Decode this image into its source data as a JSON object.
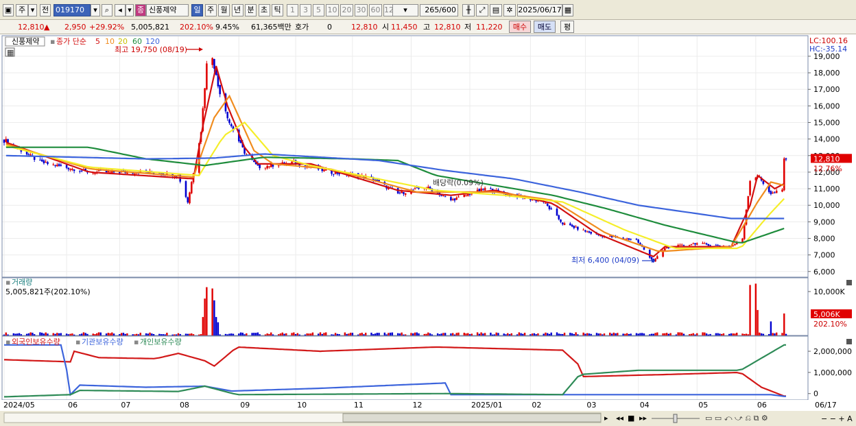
{
  "toolbar": {
    "market_primary": "주",
    "market_type": "전",
    "code": "019170",
    "name_badge": "종",
    "name": "신풍제약",
    "periods": [
      "일",
      "주",
      "월",
      "년",
      "분",
      "초",
      "틱"
    ],
    "active_period": "일",
    "intervals": [
      "1",
      "3",
      "5",
      "10",
      "20",
      "30",
      "60",
      "120"
    ],
    "count": "265",
    "count_max": "/600",
    "date": "2025/06/17"
  },
  "quote": {
    "price": "12,810",
    "change": "2,950",
    "change_pct": "+29.92%",
    "volume": "5,005,821",
    "volume_ratio": "202.10%",
    "turnover": "9.45%",
    "amount": "61,365백만",
    "ask_label": "호가",
    "ask_value": "0",
    "bid_value": "12,810",
    "open_label": "시",
    "open_value": "11,450",
    "high_label": "고",
    "high_value": "12,810",
    "low_label": "저",
    "low_value": "11,220",
    "buy_label": "매수",
    "sell_label": "매도",
    "eval_label": "평"
  },
  "colors": {
    "up": "#e00000",
    "down": "#0000d0",
    "ma5": "#d21010",
    "ma10": "#f08c1e",
    "ma20": "#f5ee2a",
    "ma60": "#1e8c3c",
    "ma120": "#3c64dc",
    "foreign": "#d21818",
    "institution": "#3c64dc",
    "individual": "#2e8b57"
  },
  "chart_data": [
    {
      "type": "candlestick",
      "title": "신풍제약",
      "legend": [
        "종가 단순",
        "5",
        "10",
        "20",
        "60",
        "120"
      ],
      "legend_placement": "top-left",
      "y_ticks": [
        "19,000",
        "18,000",
        "17,000",
        "16,000",
        "15,000",
        "14,000",
        "13,000",
        "12,000",
        "11,000",
        "10,000",
        "9,000",
        "8,000",
        "7,000",
        "6,000"
      ],
      "ylim": [
        5700,
        20200
      ],
      "x_ticks": [
        "2024/05",
        "06",
        "07",
        "08",
        "09",
        "10",
        "11",
        "12",
        "2025/01",
        "02",
        "03",
        "04",
        "05",
        "06",
        "06/17"
      ],
      "top_labels": [
        "LC:100.16",
        "HC:-35.14"
      ],
      "last_price_label": "12,810",
      "last_pct_label": "12.76%",
      "annotations": [
        "최고 19,750 (08/19)",
        "최저 6,400 (04/09)",
        "배당락(0.09%)"
      ],
      "close_keypoints": [
        {
          "date": "2024-05-02",
          "close": 13900
        },
        {
          "date": "2024-05-20",
          "close": 12600
        },
        {
          "date": "2024-06-15",
          "close": 12000
        },
        {
          "date": "2024-07-20",
          "close": 12000
        },
        {
          "date": "2024-08-01",
          "close": 11800
        },
        {
          "date": "2024-08-06",
          "close": 10200
        },
        {
          "date": "2024-08-09",
          "close": 12000
        },
        {
          "date": "2024-08-13",
          "close": 14500
        },
        {
          "date": "2024-08-16",
          "close": 18500
        },
        {
          "date": "2024-08-19",
          "close": 19000
        },
        {
          "date": "2024-08-22",
          "close": 17200
        },
        {
          "date": "2024-08-28",
          "close": 15000
        },
        {
          "date": "2024-09-05",
          "close": 13200
        },
        {
          "date": "2024-09-12",
          "close": 12300
        },
        {
          "date": "2024-10-01",
          "close": 12600
        },
        {
          "date": "2024-10-20",
          "close": 12000
        },
        {
          "date": "2024-11-10",
          "close": 11700
        },
        {
          "date": "2024-11-25",
          "close": 10700
        },
        {
          "date": "2024-12-10",
          "close": 11100
        },
        {
          "date": "2024-12-23",
          "close": 10300
        },
        {
          "date": "2025-01-10",
          "close": 11000
        },
        {
          "date": "2025-01-25",
          "close": 10600
        },
        {
          "date": "2025-02-10",
          "close": 10200
        },
        {
          "date": "2025-02-20",
          "close": 8900
        },
        {
          "date": "2025-03-10",
          "close": 8200
        },
        {
          "date": "2025-03-31",
          "close": 7900
        },
        {
          "date": "2025-04-09",
          "close": 6600
        },
        {
          "date": "2025-04-15",
          "close": 7400
        },
        {
          "date": "2025-05-01",
          "close": 7700
        },
        {
          "date": "2025-05-20",
          "close": 7500
        },
        {
          "date": "2025-05-26",
          "close": 8000
        },
        {
          "date": "2025-05-30",
          "close": 11500
        },
        {
          "date": "2025-06-03",
          "close": 11800
        },
        {
          "date": "2025-06-10",
          "close": 10700
        },
        {
          "date": "2025-06-16",
          "close": 10900
        },
        {
          "date": "2025-06-17",
          "close": 12810
        }
      ],
      "ma_series": [
        {
          "name": "5",
          "points": [
            {
              "date": "2024-05-02",
              "value": 13800
            },
            {
              "date": "2024-06-15",
              "value": 12000
            },
            {
              "date": "2024-08-09",
              "value": 11600
            },
            {
              "date": "2024-08-14",
              "value": 14800
            },
            {
              "date": "2024-08-21",
              "value": 18400
            },
            {
              "date": "2024-08-27",
              "value": 16000
            },
            {
              "date": "2024-09-05",
              "value": 13500
            },
            {
              "date": "2024-09-12",
              "value": 12500
            },
            {
              "date": "2024-10-10",
              "value": 12500
            },
            {
              "date": "2024-11-25",
              "value": 10900
            },
            {
              "date": "2024-12-23",
              "value": 10600
            },
            {
              "date": "2025-01-15",
              "value": 10900
            },
            {
              "date": "2025-02-15",
              "value": 10100
            },
            {
              "date": "2025-03-10",
              "value": 8300
            },
            {
              "date": "2025-04-09",
              "value": 6900
            },
            {
              "date": "2025-04-15",
              "value": 7500
            },
            {
              "date": "2025-05-20",
              "value": 7500
            },
            {
              "date": "2025-05-30",
              "value": 10000
            },
            {
              "date": "2025-06-03",
              "value": 11800
            },
            {
              "date": "2025-06-12",
              "value": 11000
            },
            {
              "date": "2025-06-17",
              "value": 11300
            }
          ]
        },
        {
          "name": "10",
          "points": [
            {
              "date": "2024-05-02",
              "value": 13700
            },
            {
              "date": "2024-06-15",
              "value": 12200
            },
            {
              "date": "2024-08-09",
              "value": 11700
            },
            {
              "date": "2024-08-20",
              "value": 15300
            },
            {
              "date": "2024-08-28",
              "value": 16600
            },
            {
              "date": "2024-09-10",
              "value": 13300
            },
            {
              "date": "2024-09-20",
              "value": 12500
            },
            {
              "date": "2024-10-20",
              "value": 12200
            },
            {
              "date": "2024-12-05",
              "value": 10800
            },
            {
              "date": "2025-01-15",
              "value": 10800
            },
            {
              "date": "2025-02-15",
              "value": 10300
            },
            {
              "date": "2025-03-15",
              "value": 8300
            },
            {
              "date": "2025-04-12",
              "value": 7200
            },
            {
              "date": "2025-05-20",
              "value": 7500
            },
            {
              "date": "2025-06-03",
              "value": 10200
            },
            {
              "date": "2025-06-10",
              "value": 11400
            },
            {
              "date": "2025-06-17",
              "value": 11200
            }
          ]
        },
        {
          "name": "20",
          "points": [
            {
              "date": "2024-05-02",
              "value": 13600
            },
            {
              "date": "2024-06-15",
              "value": 12300
            },
            {
              "date": "2024-08-12",
              "value": 11800
            },
            {
              "date": "2024-08-25",
              "value": 14200
            },
            {
              "date": "2024-09-05",
              "value": 15000
            },
            {
              "date": "2024-09-20",
              "value": 13000
            },
            {
              "date": "2024-10-10",
              "value": 12400
            },
            {
              "date": "2024-12-15",
              "value": 10900
            },
            {
              "date": "2025-01-20",
              "value": 10600
            },
            {
              "date": "2025-02-20",
              "value": 10200
            },
            {
              "date": "2025-03-25",
              "value": 8500
            },
            {
              "date": "2025-04-20",
              "value": 7400
            },
            {
              "date": "2025-05-25",
              "value": 7400
            },
            {
              "date": "2025-06-08",
              "value": 9300
            },
            {
              "date": "2025-06-17",
              "value": 10400
            }
          ]
        },
        {
          "name": "60",
          "points": [
            {
              "date": "2024-05-02",
              "value": 13500
            },
            {
              "date": "2024-06-15",
              "value": 13500
            },
            {
              "date": "2024-07-15",
              "value": 12800
            },
            {
              "date": "2024-08-15",
              "value": 12400
            },
            {
              "date": "2024-09-15",
              "value": 12900
            },
            {
              "date": "2024-11-01",
              "value": 12800
            },
            {
              "date": "2024-11-25",
              "value": 12700
            },
            {
              "date": "2024-12-15",
              "value": 11800
            },
            {
              "date": "2025-01-15",
              "value": 11200
            },
            {
              "date": "2025-02-15",
              "value": 10600
            },
            {
              "date": "2025-03-15",
              "value": 9800
            },
            {
              "date": "2025-04-15",
              "value": 8800
            },
            {
              "date": "2025-05-25",
              "value": 7700
            },
            {
              "date": "2025-06-17",
              "value": 8600
            }
          ]
        },
        {
          "name": "120",
          "points": [
            {
              "date": "2024-05-02",
              "value": 13000
            },
            {
              "date": "2024-07-15",
              "value": 12800
            },
            {
              "date": "2024-08-20",
              "value": 12850
            },
            {
              "date": "2024-09-15",
              "value": 13100
            },
            {
              "date": "2024-11-15",
              "value": 12700
            },
            {
              "date": "2024-12-20",
              "value": 12100
            },
            {
              "date": "2025-01-25",
              "value": 11600
            },
            {
              "date": "2025-03-01",
              "value": 10800
            },
            {
              "date": "2025-04-01",
              "value": 10000
            },
            {
              "date": "2025-05-20",
              "value": 9200
            },
            {
              "date": "2025-06-17",
              "value": 9200
            }
          ]
        }
      ]
    },
    {
      "type": "bar",
      "title": "거래량",
      "value_label": "5,005,821주(202.10%)",
      "y_ticks": [
        "10,000K"
      ],
      "last_label": "5,006K",
      "last_pct_label": "202.10%",
      "spikes_k": [
        {
          "date": "2024-08-14",
          "value": 4200
        },
        {
          "date": "2024-08-15",
          "value": 8400
        },
        {
          "date": "2024-08-16",
          "value": 11000
        },
        {
          "date": "2024-08-19",
          "value": 10700
        },
        {
          "date": "2024-08-20",
          "value": 8000
        },
        {
          "date": "2024-08-21",
          "value": 4200
        },
        {
          "date": "2024-08-22",
          "value": 3000
        },
        {
          "date": "2025-05-30",
          "value": 11500
        },
        {
          "date": "2025-06-02",
          "value": 11800
        },
        {
          "date": "2025-06-03",
          "value": 5800
        },
        {
          "date": "2025-06-10",
          "value": 3200
        },
        {
          "date": "2025-06-17",
          "value": 5006
        }
      ]
    },
    {
      "type": "line",
      "legend": [
        "외국인보유수량",
        "기관보유수량",
        "개인보유수량"
      ],
      "y_ticks": [
        "2,000,000",
        "1,000,000",
        "0"
      ],
      "series": [
        {
          "name": "외국인보유수량",
          "points": [
            {
              "date": "2024-05-02",
              "value": 1600000
            },
            {
              "date": "2024-06-05",
              "value": 1500000
            },
            {
              "date": "2024-06-07",
              "value": 2000000
            },
            {
              "date": "2024-06-20",
              "value": 1700000
            },
            {
              "date": "2024-07-20",
              "value": 1650000
            },
            {
              "date": "2024-08-01",
              "value": 1900000
            },
            {
              "date": "2024-08-15",
              "value": 1550000
            },
            {
              "date": "2024-08-20",
              "value": 1300000
            },
            {
              "date": "2024-09-01",
              "value": 2200000
            },
            {
              "date": "2024-10-15",
              "value": 2000000
            },
            {
              "date": "2024-12-15",
              "value": 2200000
            },
            {
              "date": "2025-02-20",
              "value": 2050000
            },
            {
              "date": "2025-02-28",
              "value": 1400000
            },
            {
              "date": "2025-03-01",
              "value": 800000
            },
            {
              "date": "2025-04-15",
              "value": 900000
            },
            {
              "date": "2025-05-25",
              "value": 1000000
            },
            {
              "date": "2025-06-05",
              "value": 300000
            },
            {
              "date": "2025-06-17",
              "value": -120000
            }
          ]
        },
        {
          "name": "기관보유수량",
          "points": [
            {
              "date": "2024-05-02",
              "value": 2300000
            },
            {
              "date": "2024-06-01",
              "value": 2300000
            },
            {
              "date": "2024-06-05",
              "value": -50000
            },
            {
              "date": "2024-06-10",
              "value": 400000
            },
            {
              "date": "2024-07-15",
              "value": 300000
            },
            {
              "date": "2024-08-15",
              "value": 350000
            },
            {
              "date": "2024-08-29",
              "value": 120000
            },
            {
              "date": "2024-10-15",
              "value": 250000
            },
            {
              "date": "2024-12-20",
              "value": 500000
            },
            {
              "date": "2024-12-23",
              "value": -50000
            },
            {
              "date": "2025-02-20",
              "value": -50000
            },
            {
              "date": "2025-06-10",
              "value": -50000
            },
            {
              "date": "2025-06-17",
              "value": -130000
            }
          ]
        },
        {
          "name": "개인보유수량",
          "points": [
            {
              "date": "2024-05-02",
              "value": -150000
            },
            {
              "date": "2024-06-05",
              "value": -50000
            },
            {
              "date": "2024-06-10",
              "value": 150000
            },
            {
              "date": "2024-08-01",
              "value": 100000
            },
            {
              "date": "2024-08-15",
              "value": 350000
            },
            {
              "date": "2024-09-01",
              "value": -50000
            },
            {
              "date": "2024-12-20",
              "value": 0
            },
            {
              "date": "2025-02-20",
              "value": -50000
            },
            {
              "date": "2025-03-01",
              "value": 900000
            },
            {
              "date": "2025-04-01",
              "value": 1100000
            },
            {
              "date": "2025-05-25",
              "value": 1100000
            },
            {
              "date": "2025-06-17",
              "value": 2300000
            }
          ]
        }
      ]
    }
  ]
}
